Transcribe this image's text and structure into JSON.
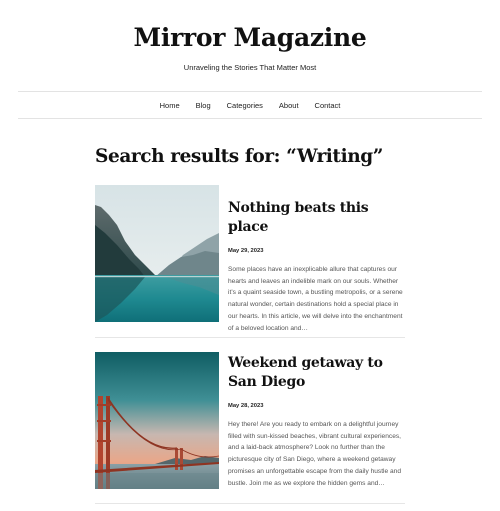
{
  "site": {
    "title": "Mirror Magazine",
    "tagline": "Unraveling the Stories That Matter Most"
  },
  "nav": {
    "items": [
      {
        "label": "Home"
      },
      {
        "label": "Blog"
      },
      {
        "label": "Categories"
      },
      {
        "label": "About"
      },
      {
        "label": "Contact"
      }
    ]
  },
  "search": {
    "heading": "Search results for: “Writing”"
  },
  "posts": [
    {
      "title": "Nothing beats this place",
      "date": "May 29, 2023",
      "excerpt": "Some places have an inexplicable allure that captures our hearts and leaves an indelible mark on our souls. Whether it’s a quaint seaside town, a bustling metropolis, or a serene natural wonder, certain destinations hold a special place in our hearts. In this article, we will delve into the enchantment of a beloved location and…",
      "image": "mountain-lake-image"
    },
    {
      "title": "Weekend getaway to San Diego",
      "date": "May 28, 2023",
      "excerpt": "Hey there! Are you ready to embark on a delightful journey filled with sun-kissed beaches, vibrant cultural experiences, and a laid-back atmosphere? Look no further than the picturesque city of San Diego, where a weekend getaway promises an unforgettable escape from the daily hustle and bustle. Join me as we explore the hidden gems and…",
      "image": "bridge-sunset-image"
    }
  ]
}
